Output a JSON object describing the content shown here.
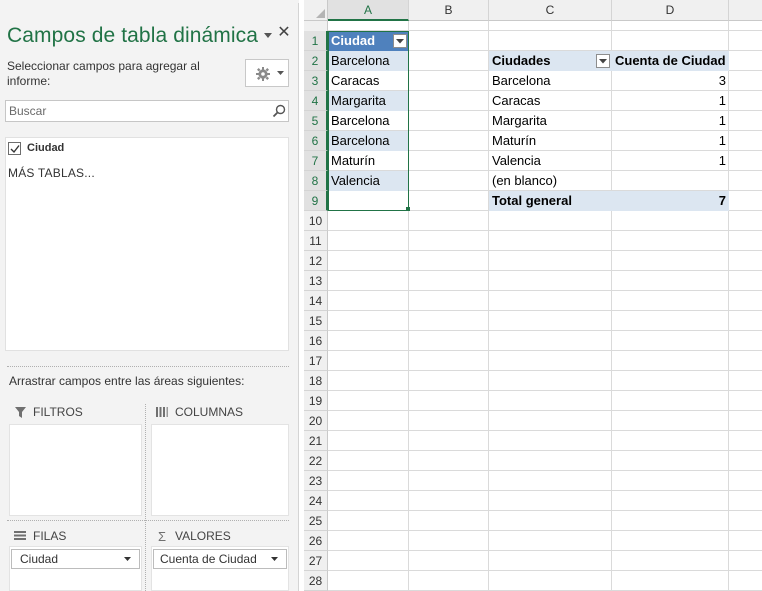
{
  "pane": {
    "title": "Campos de tabla dinámica",
    "subtitle": "Seleccionar campos para agregar al informe:",
    "search_placeholder": "Buscar",
    "field": {
      "label": "Ciudad",
      "checked": true
    },
    "more_tables": "MÁS TABLAS...",
    "drag_hint": "Arrastrar campos entre las áreas siguientes:",
    "areas": {
      "filters": {
        "label": "FILTROS",
        "icon": "filter-icon"
      },
      "columns": {
        "label": "COLUMNAS",
        "icon": "columns-icon"
      },
      "rows": {
        "label": "FILAS",
        "icon": "rows-icon",
        "item": "Ciudad"
      },
      "values": {
        "label": "VALORES",
        "icon": "sigma-icon",
        "item": "Cuenta de Ciudad"
      }
    }
  },
  "sheet": {
    "columns": [
      "A",
      "B",
      "C",
      "D"
    ],
    "rows": [
      "1",
      "2",
      "3",
      "4",
      "5",
      "6",
      "7",
      "8",
      "9",
      "10",
      "11",
      "12",
      "13",
      "14",
      "15",
      "16",
      "17",
      "18",
      "19",
      "20",
      "21",
      "22",
      "23",
      "24",
      "25",
      "26",
      "27",
      "28"
    ],
    "column_a": {
      "header": "Ciudad",
      "values": [
        "Barcelona",
        "Caracas",
        "Margarita",
        "Barcelona",
        "Barcelona",
        "Maturín",
        "Valencia"
      ]
    },
    "pivot": {
      "header_label": "Ciudades",
      "header_value": "Cuenta de Ciudad",
      "rows": [
        {
          "label": "Barcelona",
          "value": "3"
        },
        {
          "label": "Caracas",
          "value": "1"
        },
        {
          "label": "Margarita",
          "value": "1"
        },
        {
          "label": "Maturín",
          "value": "1"
        },
        {
          "label": "Valencia",
          "value": "1"
        },
        {
          "label": "(en blanco)",
          "value": ""
        }
      ],
      "total_label": "Total general",
      "total_value": "7"
    },
    "band_color": "#dce6f1",
    "header_fill_color": "#4f81bd",
    "accent_color": "#217346"
  }
}
